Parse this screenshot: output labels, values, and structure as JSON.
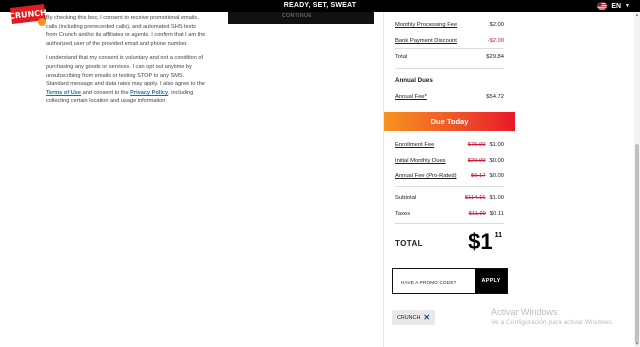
{
  "header": {
    "title": "READY, SET, SWEAT",
    "language": "EN",
    "logo_text": "CRUNCH"
  },
  "continue_button_label": "CONTINUE",
  "consent": {
    "paragraph1_pre": "By checking this box, I consent to receive promotional emails, calls (including prerecorded calls), and automated SHS texts from Crunch and/or its affiliates or agents. I confirm that I am the authorized user of the provided email and phone number.",
    "paragraph2_pre": "I understand that my consent is voluntary and not a condition of purchasing any goods or services. I can opt out anytime by unsubscribing from emails or texting STOP to any SMS. Standard message and data rates may apply. I also agree to the ",
    "terms_link": "Terms of Use",
    "paragraph2_mid": " and consent to the ",
    "privacy_link": "Privacy Policy",
    "paragraph2_post": ", including collecting certain location and usage information."
  },
  "summary": {
    "monthly_processing_fee": {
      "label": "Monthly Processing Fee",
      "amount": "$2.00"
    },
    "bank_payment_discount": {
      "label": "Bank Payment Discount",
      "amount": "-$2.00"
    },
    "total": {
      "label": "Total",
      "amount": "$29.84"
    },
    "annual_dues_title": "Annual Dues",
    "annual_fee": {
      "label": "Annual Fee*",
      "amount": "$54.72"
    },
    "due_today_title": "Due Today",
    "enrollment_fee": {
      "label": "Enrollment Fee",
      "original": "$75.00",
      "amount": "$1.00"
    },
    "initial_monthly_dues": {
      "label": "Initial Monthly Dues",
      "original": "$29.99",
      "amount": "$0.00"
    },
    "annual_fee_prorated": {
      "label": "Annual Fee (Pro-Rated)",
      "original": "$9.17",
      "amount": "$0.00"
    },
    "subtotal": {
      "label": "Subtotal",
      "original": "$114.16",
      "amount": "$1.00"
    },
    "taxes": {
      "label": "Taxes",
      "original": "$11.99",
      "amount": "$0.11"
    },
    "grand_total": {
      "label": "TOTAL",
      "dollars": "$1",
      "cents": "11"
    }
  },
  "promo": {
    "placeholder": "HAVE A PROMO CODE?",
    "apply_label": "APPLY",
    "applied_code": "CRUNCH"
  },
  "watermark": {
    "line1": "Activar Windows",
    "line2": "Ve a Configuración para activar Windows."
  },
  "colors": {
    "accent_negative": "#d1182e",
    "gradient_start": "#f7931e",
    "gradient_end": "#e8192c",
    "link": "#1b6fb5"
  }
}
